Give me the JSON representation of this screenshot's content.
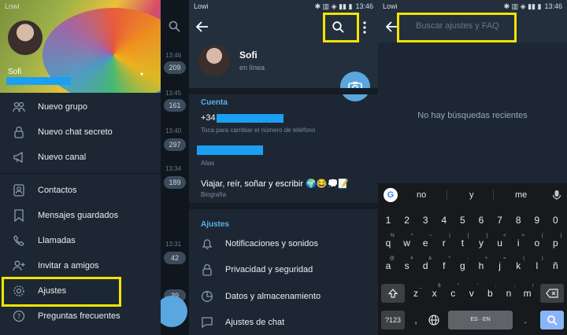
{
  "status": {
    "carrier": "Lowi",
    "icons": "✱ ▥ ◈ ▮▮ ▮",
    "time": "13:46"
  },
  "panel1": {
    "user_name": "Sofi",
    "caret": "▾",
    "menu": [
      {
        "label": "Nuevo grupo",
        "icon": "group-icon"
      },
      {
        "label": "Nuevo chat secreto",
        "icon": "lock-icon"
      },
      {
        "label": "Nuevo canal",
        "icon": "megaphone-icon"
      },
      {
        "label": "Contactos",
        "icon": "contacts-icon"
      },
      {
        "label": "Mensajes guardados",
        "icon": "bookmark-icon"
      },
      {
        "label": "Llamadas",
        "icon": "phone-icon"
      },
      {
        "label": "Invitar a amigos",
        "icon": "add-person-icon"
      },
      {
        "label": "Ajustes",
        "icon": "gear-icon"
      },
      {
        "label": "Preguntas frecuentes",
        "icon": "help-icon"
      }
    ],
    "chat_times": [
      "13:46",
      "13:45",
      "13:40",
      "13:34",
      "13:31"
    ],
    "chat_badges": [
      "209",
      "161",
      "297",
      "189",
      "42",
      "39"
    ]
  },
  "panel2": {
    "profile_name": "Sofi",
    "profile_status": "en línea",
    "account_title": "Cuenta",
    "phone_prefix": "+34",
    "phone_hint": "Toca para cambiar el número de teléfono",
    "alias_hint": "Alias",
    "bio": "Viajar, reír, soñar y escribir 🌍😂💭📝",
    "bio_hint": "Biografía",
    "settings_title": "Ajustes",
    "settings_items": [
      {
        "label": "Notificaciones y sonidos",
        "icon": "bell-icon"
      },
      {
        "label": "Privacidad y seguridad",
        "icon": "lock-icon"
      },
      {
        "label": "Datos y almacenamiento",
        "icon": "pie-chart-icon"
      },
      {
        "label": "Ajustes de chat",
        "icon": "chat-bubble-icon"
      }
    ]
  },
  "panel3": {
    "search_placeholder": "Buscar ajustes y FAQ",
    "empty_text": "No hay búsquedas recientes",
    "suggestions": [
      "no",
      "y",
      "me"
    ],
    "keys_row1": [
      "1",
      "2",
      "3",
      "4",
      "5",
      "6",
      "7",
      "8",
      "9",
      "0"
    ],
    "keys_row2": [
      "q",
      "w",
      "e",
      "r",
      "t",
      "y",
      "u",
      "i",
      "o",
      "p"
    ],
    "keys_row3": [
      "a",
      "s",
      "d",
      "f",
      "g",
      "h",
      "j",
      "k",
      "l",
      "ñ"
    ],
    "keys_row4": [
      "z",
      "x",
      "c",
      "v",
      "b",
      "n",
      "m"
    ],
    "hints_row2": [
      "%",
      "^",
      "~",
      "|",
      "[",
      "]",
      "<",
      ">",
      "{",
      "}"
    ],
    "hints_row3": [
      "@",
      "#",
      "&",
      "*",
      "-",
      "+",
      "=",
      "(",
      ")",
      ""
    ],
    "hints_row4": [
      "_",
      "$",
      "\"",
      "'",
      ":",
      ";",
      "/"
    ],
    "key_123": "?123",
    "key_comma": ",",
    "key_space": "ES · EN",
    "key_period": "."
  }
}
